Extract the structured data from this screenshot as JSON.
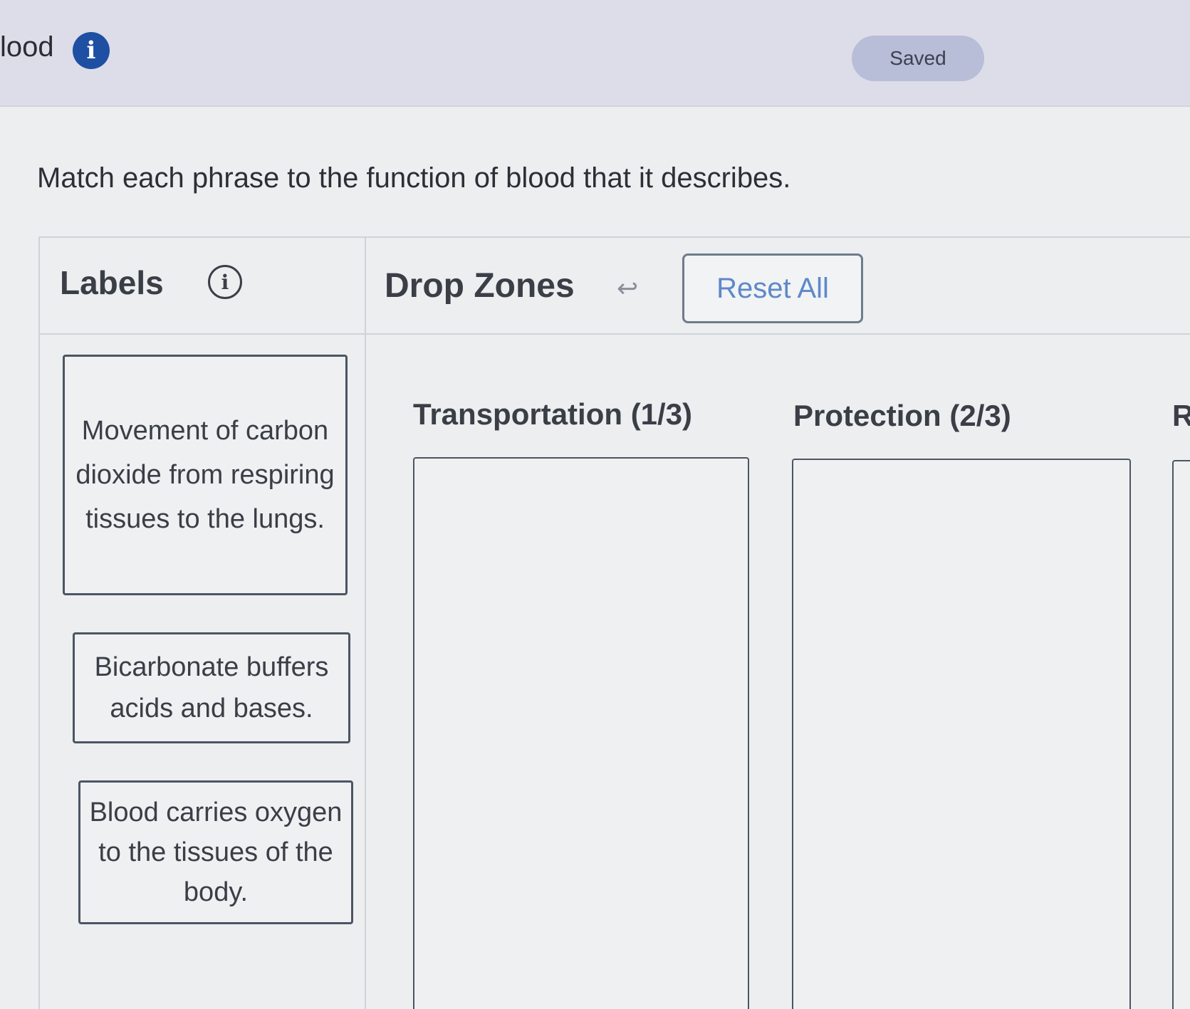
{
  "header": {
    "title": "lood",
    "info_icon": "info-circle-filled",
    "status_badge": "Saved"
  },
  "instruction": "Match each phrase to the function of blood that it describes.",
  "labels_panel": {
    "heading": "Labels",
    "info_icon": "info-circle-outline",
    "items": [
      {
        "text": "Movement of carbon dioxide from respiring tissues to the lungs."
      },
      {
        "text": "Bicarbonate buffers acids and bases."
      },
      {
        "text": "Blood carries oxygen to the tissues of the body."
      }
    ]
  },
  "dropzones_panel": {
    "heading": "Drop Zones",
    "undo_icon": "undo-arrow",
    "reset_label": "Reset All",
    "zones": [
      {
        "title": "Transportation (1/3)"
      },
      {
        "title": "Protection (2/3)"
      },
      {
        "title": "R"
      }
    ]
  },
  "colors": {
    "header_bg": "#dcdde9",
    "page_bg": "#eceef0",
    "info_icon_bg": "#1f4fa3",
    "saved_badge_bg": "#b8bdd8",
    "reset_text": "#5f88c8",
    "border": "#4c5563"
  }
}
